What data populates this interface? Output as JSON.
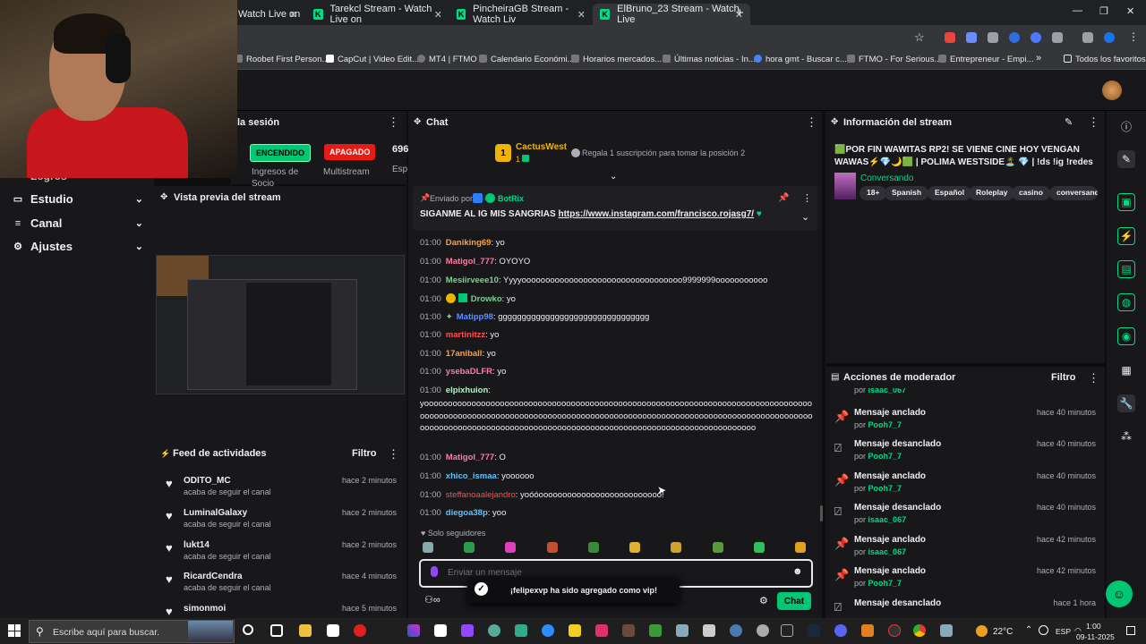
{
  "browser": {
    "tabs": [
      {
        "label": "Watch Live on"
      },
      {
        "label": "Tarekcl Stream - Watch Live on"
      },
      {
        "label": "PincheiraGB Stream - Watch Liv"
      },
      {
        "label": "ElBruno_23 Stream - Watch Live"
      }
    ],
    "new_tab": "+",
    "url_fragment": "m",
    "bookmarks": [
      "Roobet First Person...",
      "CapCut | Video Edit...",
      "MT4 | FTMO",
      "Calendario Económi...",
      "Horarios mercados...",
      "Últimas noticias - In...",
      "hora gmt - Buscar c...",
      "FTMO - For Serious...",
      "Entrepreneur - Empi..."
    ],
    "bookmarks_more": "»",
    "all_bookmarks": "Todos los favoritos"
  },
  "left_nav": {
    "partial_item": "Logros",
    "items": [
      {
        "label": "Estudio",
        "icon": "monitor-icon"
      },
      {
        "label": "Canal",
        "icon": "list-icon"
      },
      {
        "label": "Ajustes",
        "icon": "gear-icon"
      }
    ]
  },
  "session": {
    "title": "la sesión",
    "on_label": "ENCENDIDO",
    "off_label": "APAGADO",
    "ingresos_label": "Ingresos de",
    "ingresos_label2": "Socio",
    "multistream_label": "Multistream",
    "number": "696",
    "number_sub": "Esp"
  },
  "preview": {
    "title": "Vista previa del stream"
  },
  "feed": {
    "title": "Feed de actividades",
    "filter": "Filtro",
    "items": [
      {
        "name": "ODITO_MC",
        "sub": "acaba de seguir el canal",
        "time": "hace 2 minutos"
      },
      {
        "name": "LuminalGalaxy",
        "sub": "acaba de seguir el canal",
        "time": "hace 2 minutos"
      },
      {
        "name": "lukt14",
        "sub": "acaba de seguir el canal",
        "time": "hace 2 minutos"
      },
      {
        "name": "RicardCendra",
        "sub": "acaba de seguir el canal",
        "time": "hace 4 minutos"
      },
      {
        "name": "simonmoi",
        "sub": "",
        "time": "hace 5 minutos"
      }
    ]
  },
  "chat": {
    "title": "Chat",
    "leader_rank": "1",
    "leader_name": "CactusWest",
    "leader_count": "1",
    "leader_prompt": "Regala 1 suscripción para tomar la posición 2",
    "pinned_by": "Enviado por",
    "pinned_user": "BotRix",
    "pinned_text": "SIGANME AL IG MIS SANGRIAS",
    "pinned_link": "https://www.instagram.com/francisco.rojasg7/",
    "messages": [
      {
        "time": "01:00",
        "user": "Daniking69",
        "color": "#ff9e44",
        "text": ": yo"
      },
      {
        "time": "01:00",
        "user": "Matigol_777",
        "color": "#ff7aa6",
        "text": ": OYOYO"
      },
      {
        "time": "01:00",
        "user": "Mesiirveee10",
        "color": "#7bd18f",
        "text": ": Yyyyoooooooooooooooooooooooooooooooooo9999999ooooooooooo"
      },
      {
        "time": "01:00",
        "user": "Drowko",
        "color": "#7bd18f",
        "text": ": yo"
      },
      {
        "time": "01:00",
        "user": "Matipp98",
        "color": "#5c8dff",
        "text": ": gggggggggggggggggggggggggggggggg"
      },
      {
        "time": "01:00",
        "user": "martinitzz",
        "color": "#ff4f4f",
        "text": ": yo"
      },
      {
        "time": "01:00",
        "user": "17aniball",
        "color": "#ff9e44",
        "text": ": yo"
      },
      {
        "time": "01:00",
        "user": "ysebaDLFR",
        "color": "#ff7aa6",
        "text": ": yo"
      },
      {
        "time": "01:00",
        "user": "elpixhuion",
        "color": "#b7f0c8",
        "text": ":"
      }
    ],
    "long_message": "yoooooooooooooooooooooooooooooooooooooooooooooooooooooooooooooooooooooooooooooooooooooooooooooooooooooooooooooooooooooooooooooooooooooooooooooooooooooooooooooooooooooooooooooooooooooooooooooooooooooooooooooooooooooooooooooooooooooooooooo",
    "messages2": [
      {
        "time": "01:00",
        "user": "Matigol_777",
        "color": "#ff7aa6",
        "text": ": O"
      },
      {
        "time": "01:00",
        "user": "xhico_ismaa",
        "color": "#5ec4ff",
        "text": ": yoooooo"
      },
      {
        "time": "01:00",
        "user": "steffanoaalejandro",
        "color": "#ff4f4f",
        "text": ": yoóóoooooooooooooooooooooooooo!"
      },
      {
        "time": "01:00",
        "user": "diegoa38p",
        "color": "#5ec4ff",
        "text": ": yoo"
      }
    ],
    "followers_only": "Solo seguidores",
    "input_placeholder": "Enviar un mensaje",
    "vip_toast": "¡felipexvp ha sido agregado como vip!",
    "send_label": "Chat"
  },
  "info": {
    "title": "Información del stream",
    "stream_title": "🟩POR FIN WAWITAS RP2! SE VIENE CINE HOY VENGAN WAWAS⚡💎🌙🟩 | POLIMA WESTSIDE🏝️ 💎 | !ds !ig !redes",
    "category": "Conversando",
    "tags": [
      "18+",
      "Spanish",
      "Español",
      "Roleplay",
      "casino",
      "conversand"
    ]
  },
  "mod": {
    "title": "Acciones de moderador",
    "filter": "Filtro",
    "partial_by": "por",
    "partial_user": "isaac_067",
    "items": [
      {
        "action": "Mensaje anclado",
        "by": "por",
        "user": "Pooh7_7",
        "time": "hace 40 minutos",
        "icon": "pin-icon"
      },
      {
        "action": "Mensaje desanclado",
        "by": "por",
        "user": "Pooh7_7",
        "time": "hace 40 minutos",
        "icon": "unpin-icon"
      },
      {
        "action": "Mensaje anclado",
        "by": "por",
        "user": "Pooh7_7",
        "time": "hace 40 minutos",
        "icon": "pin-icon"
      },
      {
        "action": "Mensaje desanclado",
        "by": "por",
        "user": "isaac_067",
        "time": "hace 40 minutos",
        "icon": "unpin-icon"
      },
      {
        "action": "Mensaje anclado",
        "by": "por",
        "user": "isaac_067",
        "time": "hace 42 minutos",
        "icon": "pin-icon"
      },
      {
        "action": "Mensaje anclado",
        "by": "por",
        "user": "Pooh7_7",
        "time": "hace 42 minutos",
        "icon": "pin-icon"
      },
      {
        "action": "Mensaje desanclado",
        "by": "",
        "user": "",
        "time": "hace 1 hora",
        "icon": "unpin-icon"
      }
    ]
  },
  "taskbar": {
    "search_placeholder": "Escribe aquí para buscar.",
    "weather": "22°C",
    "lang": "ESP",
    "time": "1:00",
    "date": "09-11-2025"
  },
  "colors": {
    "accent_green": "#00db84",
    "purple": "#9147ff",
    "on_green": "#00c774",
    "off_red": "#e91916"
  }
}
